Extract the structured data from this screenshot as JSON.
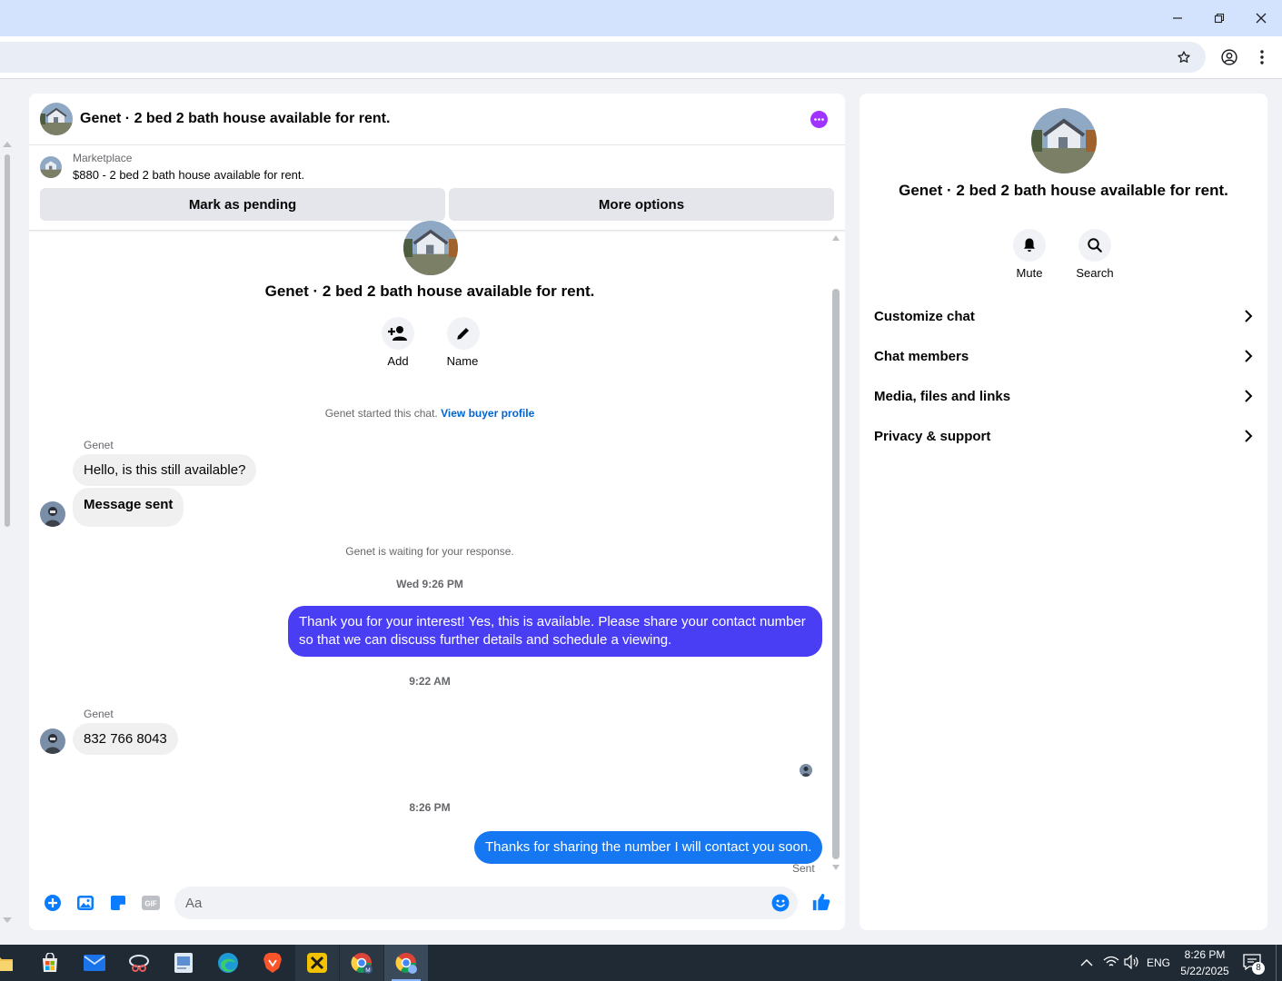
{
  "browser": {
    "window_controls": [
      "minimize",
      "restore",
      "close"
    ]
  },
  "chat": {
    "header_title": "Genet · 2 bed 2 bath house available for rent.",
    "marketplace_label": "Marketplace",
    "listing_text": "$880 - 2 bed 2 bath house available for rent.",
    "mark_pending_label": "Mark as pending",
    "more_options_label": "More options",
    "center_title": "Genet · 2 bed 2 bath house available for rent.",
    "add_label": "Add",
    "name_label": "Name",
    "started_text": "Genet started this chat.",
    "view_buyer_link": "View buyer profile",
    "messages": {
      "sender1": "Genet",
      "msg1": "Hello, is this still available?",
      "msg2": "Message sent",
      "waiting_text": "Genet is waiting for your response.",
      "time1": "Wed 9:26 PM",
      "out1": "Thank you for your interest! Yes, this is available. Please share your contact number so that we can discuss further details and schedule a viewing.",
      "time2": "9:22 AM",
      "sender2": "Genet",
      "msg3": "832 766 8043",
      "time3": "8:26 PM",
      "out2": "Thanks for sharing the number I will contact you soon.",
      "sent_status": "Sent"
    },
    "composer_placeholder": "Aa"
  },
  "info": {
    "title": "Genet · 2 bed 2 bath house available for rent.",
    "mute_label": "Mute",
    "search_label": "Search",
    "rows": [
      "Customize chat",
      "Chat members",
      "Media, files and links",
      "Privacy & support"
    ]
  },
  "taskbar": {
    "language": "ENG",
    "time": "8:26 PM",
    "date": "5/22/2025",
    "notification_count": "8"
  },
  "colors": {
    "accent_purple": "#a033ff",
    "bubble_out_1": "#4a3ef5",
    "bubble_out_2": "#1677f2",
    "messenger_blue": "#0a7cff",
    "link_blue": "#0064d1"
  }
}
